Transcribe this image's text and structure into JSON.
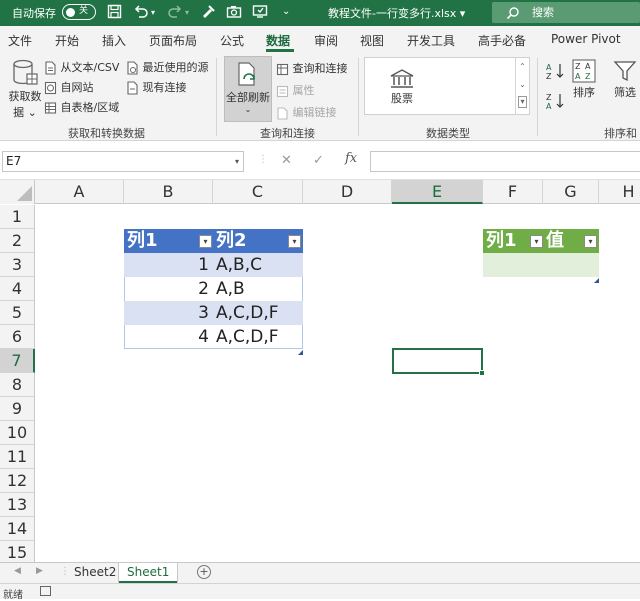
{
  "titlebar": {
    "autosave_label": "自动保存",
    "autosave_state": "关",
    "filename": "教程文件-一行变多行.xlsx",
    "filename_arrow": "▾",
    "search_placeholder": "搜索"
  },
  "tabs": [
    {
      "label": "文件"
    },
    {
      "label": "开始"
    },
    {
      "label": "插入"
    },
    {
      "label": "页面布局"
    },
    {
      "label": "公式"
    },
    {
      "label": "数据"
    },
    {
      "label": "审阅"
    },
    {
      "label": "视图"
    },
    {
      "label": "开发工具"
    },
    {
      "label": "高手必备"
    },
    {
      "label": "Power Pivot"
    }
  ],
  "active_tab": "数据",
  "ribbon": {
    "get_data_line1": "获取数",
    "get_data_line2": "据",
    "from_text_csv": "从文本/CSV",
    "from_web": "自网站",
    "from_table": "自表格/区域",
    "recent_sources": "最近使用的源",
    "existing_connections": "现有连接",
    "group_get_transform": "获取和转换数据",
    "refresh_all": "全部刷新",
    "queries_connections": "查询和连接",
    "properties": "属性",
    "edit_links": "编辑链接",
    "group_queries": "查询和连接",
    "stocks": "股票",
    "group_data_types": "数据类型",
    "sort": "排序",
    "filter": "筛选",
    "group_sort_filter": "排序和筛"
  },
  "formula_bar": {
    "name_box": "E7",
    "fx": "fx",
    "cancel_symbol": "✕",
    "enter_symbol": "✓",
    "value": ""
  },
  "columns": [
    "A",
    "B",
    "C",
    "D",
    "E",
    "F",
    "G",
    "H"
  ],
  "rows": [
    "1",
    "2",
    "3",
    "4",
    "5",
    "6",
    "7",
    "8",
    "9",
    "10",
    "11",
    "12",
    "13",
    "14",
    "15"
  ],
  "table1": {
    "headers": [
      "列1",
      "列2"
    ],
    "rows": [
      {
        "c1": "1",
        "c2": "A,B,C"
      },
      {
        "c1": "2",
        "c2": "A,B"
      },
      {
        "c1": "3",
        "c2": "A,C,D,F"
      },
      {
        "c1": "4",
        "c2": "A,C,D,F"
      }
    ]
  },
  "table2": {
    "headers": [
      "列1",
      "值"
    ]
  },
  "selected_cell": "E7",
  "sheets": [
    {
      "name": "Sheet2",
      "active": false
    },
    {
      "name": "Sheet1",
      "active": true
    }
  ],
  "status": {
    "ready": "就绪"
  },
  "colors": {
    "excel_green": "#217346",
    "table_blue": "#4472c4",
    "table_band": "#d9e1f2",
    "table_green": "#70ad47"
  }
}
